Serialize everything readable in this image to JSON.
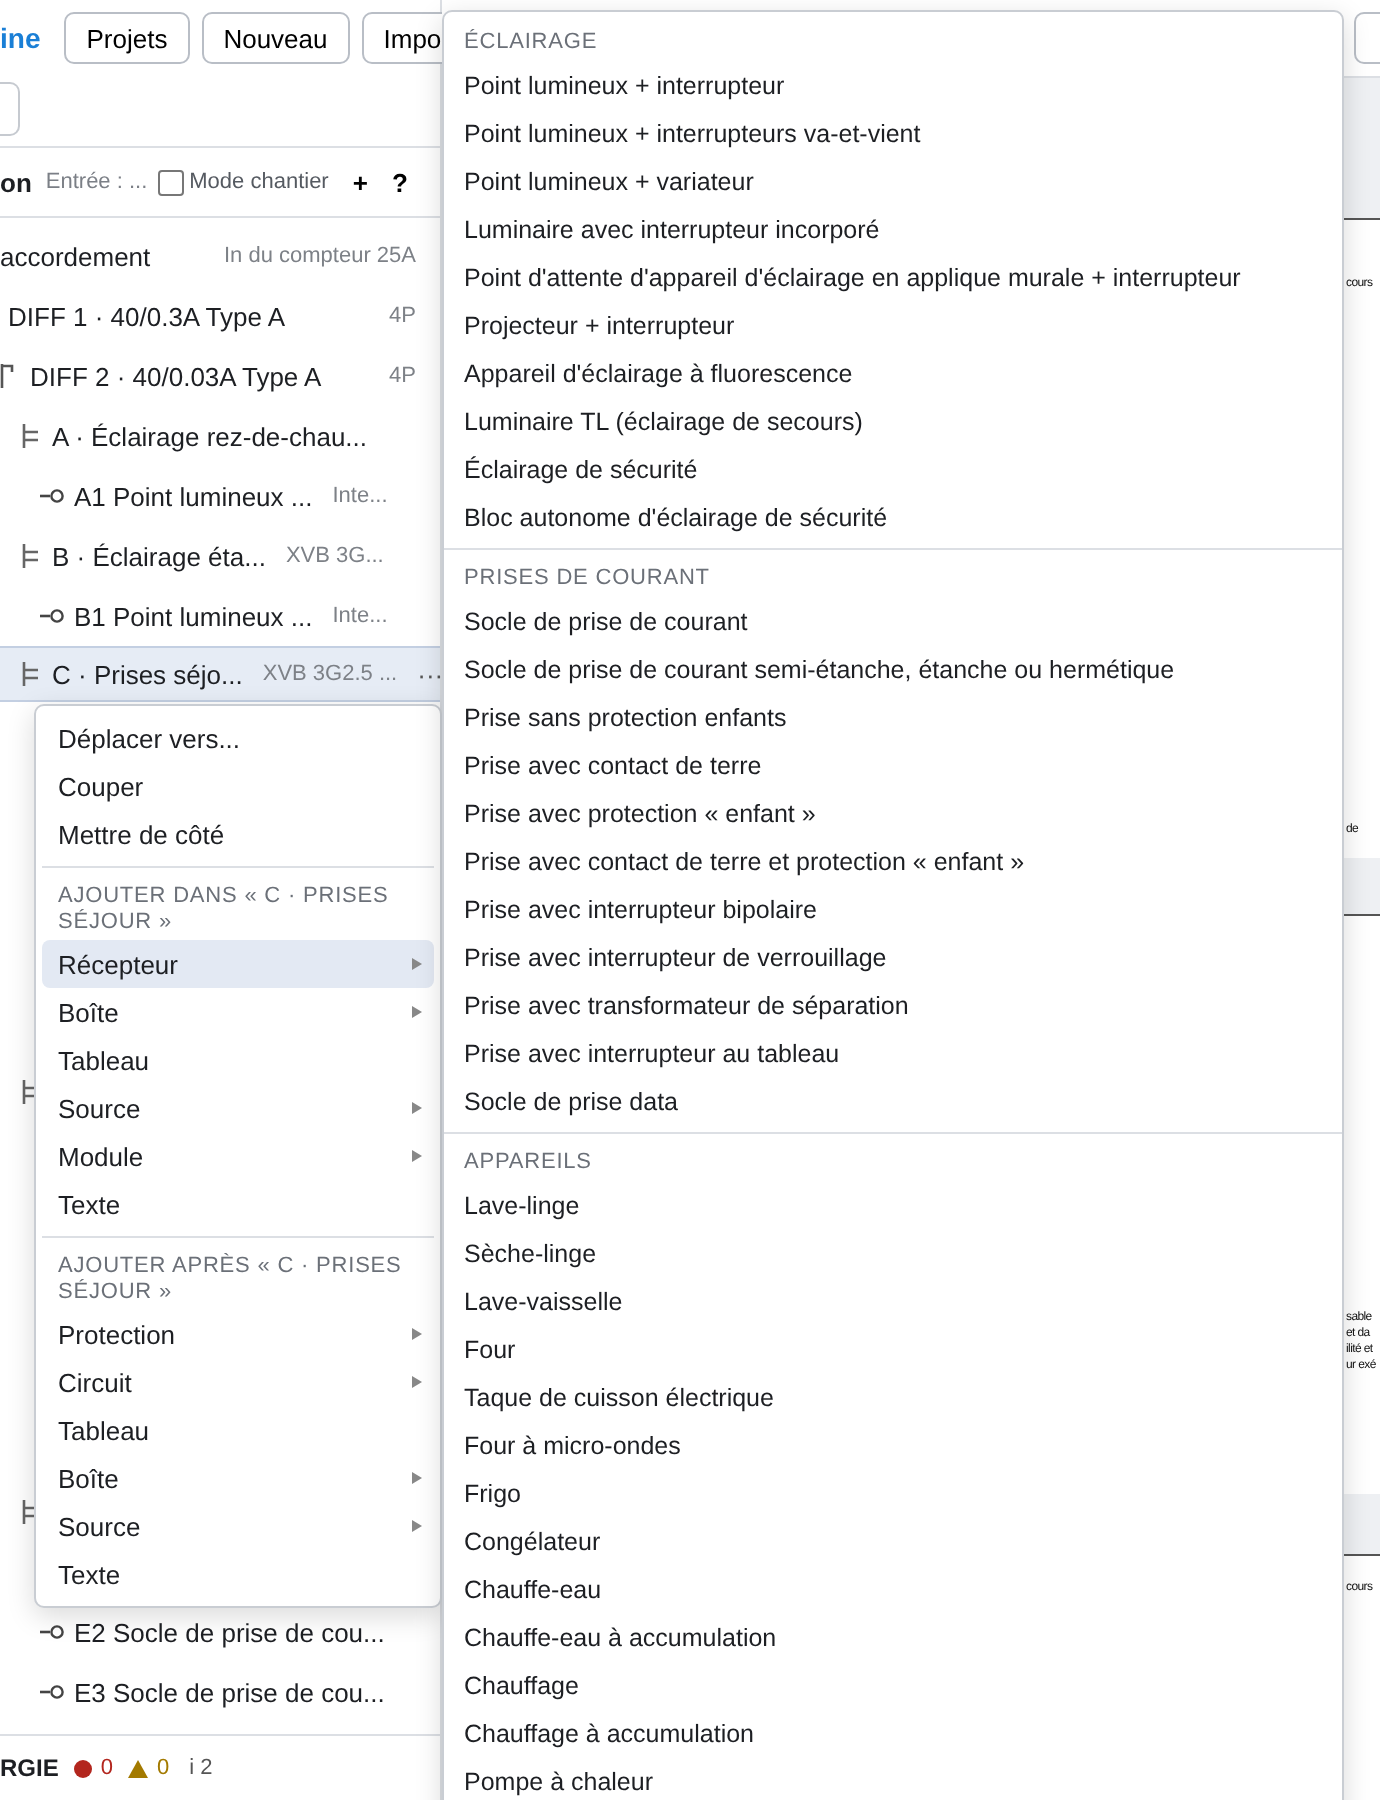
{
  "header": {
    "logo": "ine",
    "buttons": [
      "Projets",
      "Nouveau",
      "Impo"
    ]
  },
  "toolbar": {
    "title": "on",
    "entry_placeholder": "Entrée : ...",
    "mode_checkbox": {
      "label": "Mode chantier",
      "checked": false
    },
    "add": "+",
    "help": "?"
  },
  "tree": {
    "rows": [
      {
        "kind": "root",
        "label": "accordement",
        "detail": "In du compteur 25A",
        "selected": false,
        "children": [
          {
            "kind": "protection",
            "label": "DIFF 1 · 40/0.3A Type A",
            "detail": "4P",
            "selected": false,
            "children": [
              {
                "kind": "protection",
                "label": "DIFF 2 · 40/0.03A Type A",
                "detail": "4P",
                "selected": false,
                "children": [
                  {
                    "kind": "circuit",
                    "label": "A · Éclairage rez-de-chau...",
                    "selected": false,
                    "children": [
                      {
                        "kind": "receptor",
                        "label": "A1 Point lumineux ...",
                        "detail": "Inte...",
                        "selected": false
                      }
                    ]
                  },
                  {
                    "kind": "circuit",
                    "label": "B · Éclairage éta...",
                    "detail": "XVB 3G...",
                    "selected": false,
                    "children": [
                      {
                        "kind": "receptor",
                        "label": "B1 Point lumineux ...",
                        "detail": "Inte...",
                        "selected": false
                      }
                    ]
                  },
                  {
                    "kind": "circuit",
                    "label": "C · Prises séjo...",
                    "detail": "XVB 3G2.5 ...",
                    "more": "···",
                    "selected": true
                  },
                  {
                    "kind": "circuit",
                    "selected": false
                  },
                  {
                    "kind": "circuit",
                    "selected": false,
                    "children": [
                      {
                        "kind": "receptor",
                        "label": "E2 Socle de prise de cou...",
                        "selected": false
                      },
                      {
                        "kind": "receptor",
                        "label": "E3 Socle de prise de cou...",
                        "selected": false
                      }
                    ]
                  }
                ]
              }
            ]
          }
        ]
      }
    ]
  },
  "status_bar": {
    "label": "RGIE",
    "errors": "0",
    "warnings": "0",
    "infos": "i 2"
  },
  "context_menu": {
    "sections": [
      {
        "items": [
          {
            "label": "Déplacer vers...",
            "has_submenu": false,
            "selected": false
          },
          {
            "label": "Couper",
            "has_submenu": false,
            "selected": false
          },
          {
            "label": "Mettre de côté",
            "has_submenu": false,
            "selected": false
          }
        ]
      },
      {
        "header": "AJOUTER DANS « C · PRISES SÉJOUR »",
        "items": [
          {
            "label": "Récepteur",
            "has_submenu": true,
            "selected": true
          },
          {
            "label": "Boîte",
            "has_submenu": true,
            "selected": false
          },
          {
            "label": "Tableau",
            "has_submenu": false,
            "selected": false
          },
          {
            "label": "Source",
            "has_submenu": true,
            "selected": false
          },
          {
            "label": "Module",
            "has_submenu": true,
            "selected": false
          },
          {
            "label": "Texte",
            "has_submenu": false,
            "selected": false
          }
        ]
      },
      {
        "header": "AJOUTER APRÈS « C · PRISES SÉJOUR »",
        "items": [
          {
            "label": "Protection",
            "has_submenu": true,
            "selected": false
          },
          {
            "label": "Circuit",
            "has_submenu": true,
            "selected": false
          },
          {
            "label": "Tableau",
            "has_submenu": false,
            "selected": false
          },
          {
            "label": "Boîte",
            "has_submenu": true,
            "selected": false
          },
          {
            "label": "Source",
            "has_submenu": true,
            "selected": false
          },
          {
            "label": "Texte",
            "has_submenu": false,
            "selected": false
          }
        ]
      }
    ]
  },
  "submenu": {
    "sections": [
      {
        "header": "ÉCLAIRAGE",
        "items": [
          "Point lumineux + interrupteur",
          "Point lumineux + interrupteurs va-et-vient",
          "Point lumineux + variateur",
          "Luminaire avec interrupteur incorporé",
          "Point d'attente d'appareil d'éclairage en applique murale + interrupteur",
          "Projecteur + interrupteur",
          "Appareil d'éclairage à fluorescence",
          "Luminaire TL (éclairage de secours)",
          "Éclairage de sécurité",
          "Bloc autonome d'éclairage de sécurité"
        ]
      },
      {
        "header": "PRISES DE COURANT",
        "items": [
          "Socle de prise de courant",
          "Socle de prise de courant semi-étanche, étanche ou hermétique",
          "Prise sans protection enfants",
          "Prise avec contact de terre",
          "Prise avec protection « enfant »",
          "Prise avec contact de terre et protection « enfant »",
          "Prise avec interrupteur bipolaire",
          "Prise avec interrupteur de verrouillage",
          "Prise avec transformateur de séparation",
          "Prise avec interrupteur au tableau",
          "Socle de prise data"
        ]
      },
      {
        "header": "APPAREILS",
        "items": [
          "Lave-linge",
          "Sèche-linge",
          "Lave-vaisselle",
          "Four",
          "Taque de cuisson électrique",
          "Four à micro-ondes",
          "Frigo",
          "Congélateur",
          "Chauffe-eau",
          "Chauffe-eau à accumulation",
          "Chauffage",
          "Chauffage à accumulation",
          "Pompe à chaleur"
        ]
      }
    ]
  },
  "preview": {
    "pages": [
      {
        "lines": [
          "cours"
        ],
        "footer": "de"
      },
      {
        "lines": [
          "sable",
          "et da",
          "ilité et",
          "ur exé"
        ]
      },
      {
        "lines": [
          "cours"
        ]
      }
    ]
  }
}
